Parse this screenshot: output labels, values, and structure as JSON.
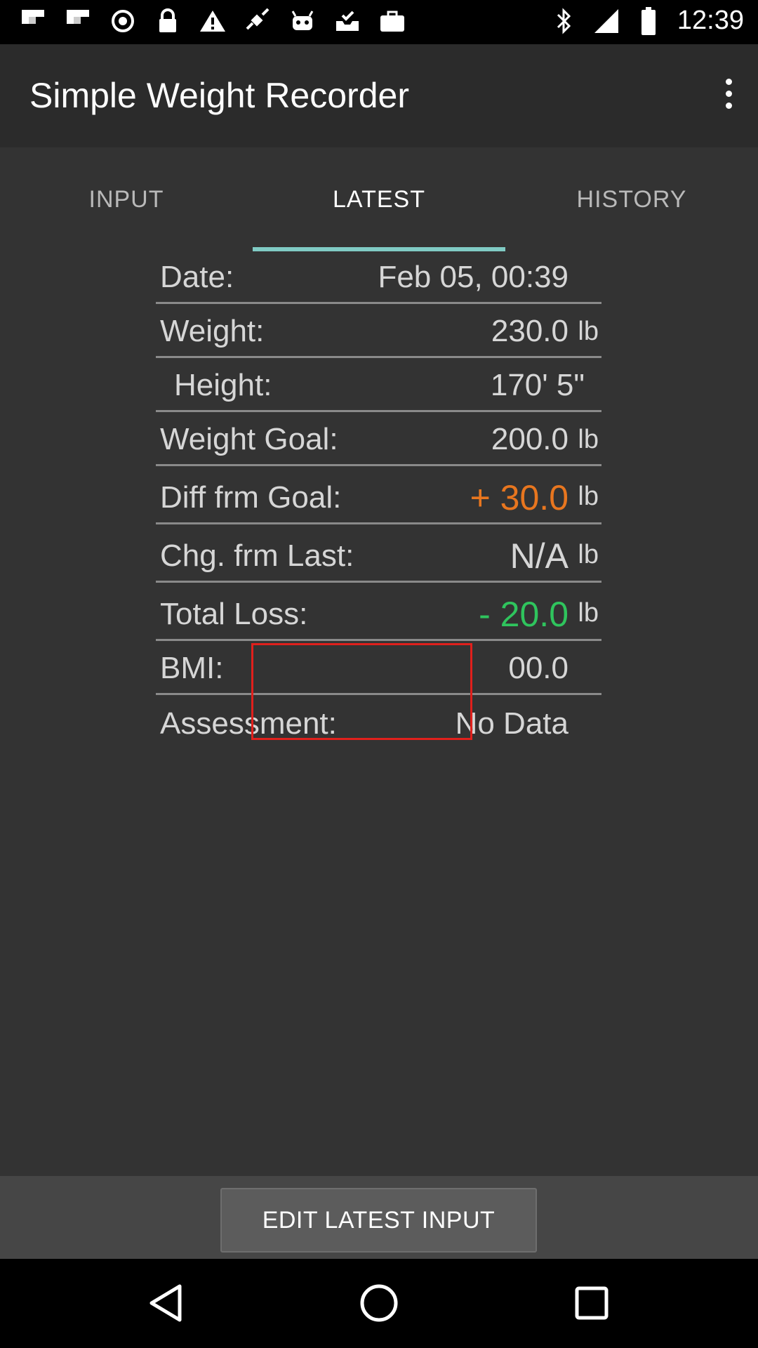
{
  "status_bar": {
    "time": "12:39",
    "icons": [
      "flipboard-icon",
      "flipboard-icon",
      "circle-icon",
      "lock-icon",
      "warning-icon",
      "fake-gps-icon",
      "android-icon",
      "inbox-check-icon",
      "briefcase-icon",
      "bluetooth-icon",
      "signal-icon",
      "battery-icon"
    ]
  },
  "app": {
    "title": "Simple Weight Recorder"
  },
  "tabs": [
    {
      "label": "INPUT",
      "active": false
    },
    {
      "label": "LATEST",
      "active": true
    },
    {
      "label": "HISTORY",
      "active": false
    }
  ],
  "rows": {
    "date": {
      "label": "Date:",
      "value": "Feb 05, 00:39"
    },
    "weight": {
      "label": "Weight:",
      "value": "230.0",
      "unit": "lb"
    },
    "height": {
      "label": "Height:",
      "value": "170' 5\""
    },
    "goal": {
      "label": "Weight Goal:",
      "value": "200.0",
      "unit": "lb"
    },
    "diff": {
      "label": "Diff frm Goal:",
      "value": "+ 30.0",
      "unit": "lb"
    },
    "change": {
      "label": "Chg. frm Last:",
      "value": "N/A",
      "unit": "lb"
    },
    "loss": {
      "label": "Total Loss:",
      "value": "- 20.0",
      "unit": "lb"
    },
    "bmi": {
      "label": "BMI:",
      "value": "00.0"
    },
    "assessment": {
      "label": "Assessment:",
      "value": "No Data"
    }
  },
  "edit_button": {
    "label": "EDIT LATEST INPUT"
  },
  "colors": {
    "accent_tab": "#80cbc4",
    "positive_diff": "#e8761f",
    "loss": "#2fc45d",
    "highlight": "#e0201c"
  }
}
